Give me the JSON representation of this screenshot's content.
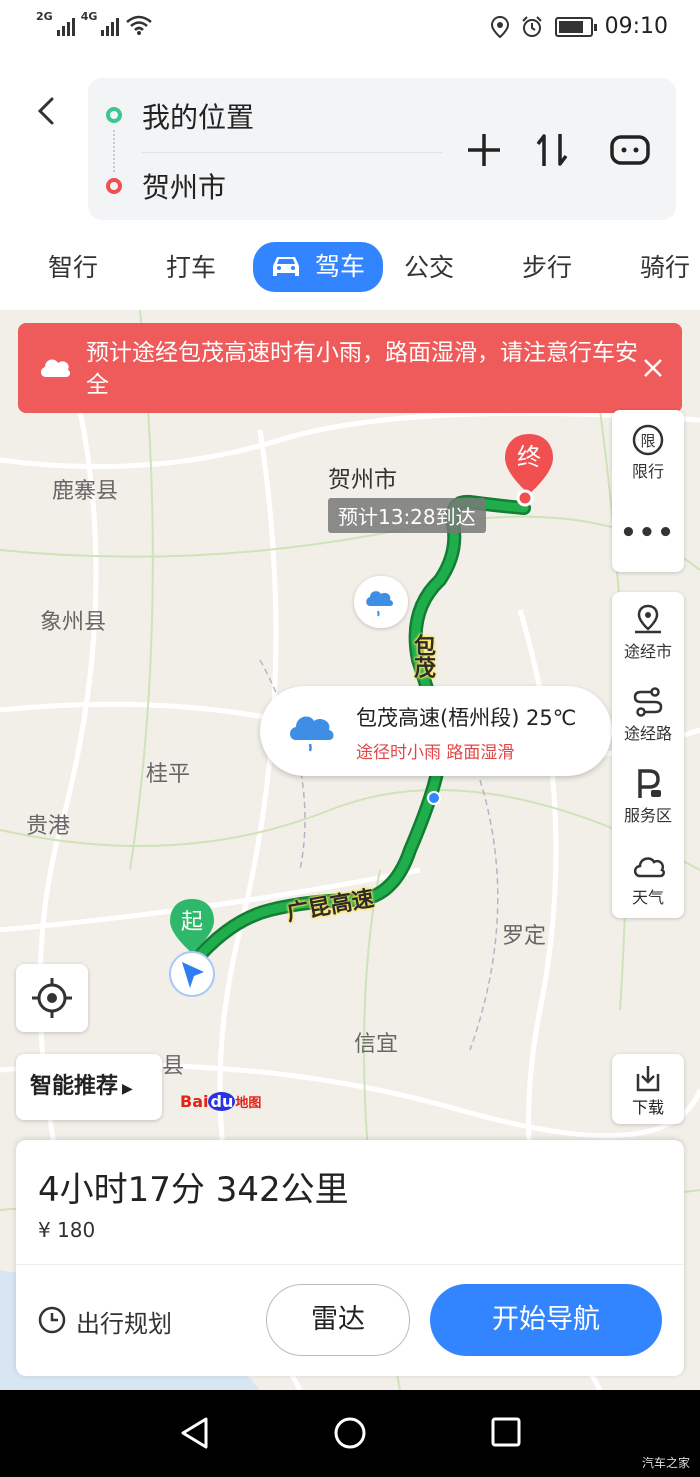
{
  "status_bar": {
    "net1": "2G",
    "net2": "4G",
    "time": "09:10"
  },
  "route": {
    "start": "我的位置",
    "end": "贺州市"
  },
  "tabs": [
    "智行",
    "打车",
    "驾车",
    "公交",
    "步行",
    "骑行"
  ],
  "active_tab": "驾车",
  "alert": {
    "text": "预计途经包茂高速时有小雨，路面湿滑，请注意行车安全"
  },
  "map": {
    "places": {
      "luzhai": "鹿寨县",
      "xiangzhou": "象州县",
      "guiping": "桂平",
      "guigang": "贵港",
      "luoding": "罗定",
      "xinyi": "信宜",
      "tengxian": "县"
    },
    "destination_label": "贺州市",
    "eta": "预计13:28到达",
    "end_pin": "终",
    "start_pin": "起",
    "road_labels": {
      "baomao": "包茂",
      "guangkun": "广昆高速"
    },
    "weather_card": {
      "title": "包茂高速(梧州段) 25℃",
      "subtitle": "途径时小雨 路面湿滑"
    },
    "brand": {
      "bai": "Bai",
      "du": "du",
      "map": "地图"
    }
  },
  "side_panel": {
    "restrict_label": "限行",
    "restrict_icon_text": "限",
    "via_city": "途经市",
    "via_road": "途经路",
    "service_area": "服务区",
    "weather": "天气",
    "download": "下载"
  },
  "smart_recommend": "智能推荐",
  "summary": {
    "duration_distance": "4小时17分  342公里",
    "toll": "¥ 180"
  },
  "actions": {
    "plan": "出行规划",
    "radar": "雷达",
    "start_nav": "开始导航"
  },
  "colors": {
    "accent": "#3385ff",
    "alert": "#ef5a5a",
    "route": "#1fae4b"
  },
  "watermark": "汽车之家"
}
